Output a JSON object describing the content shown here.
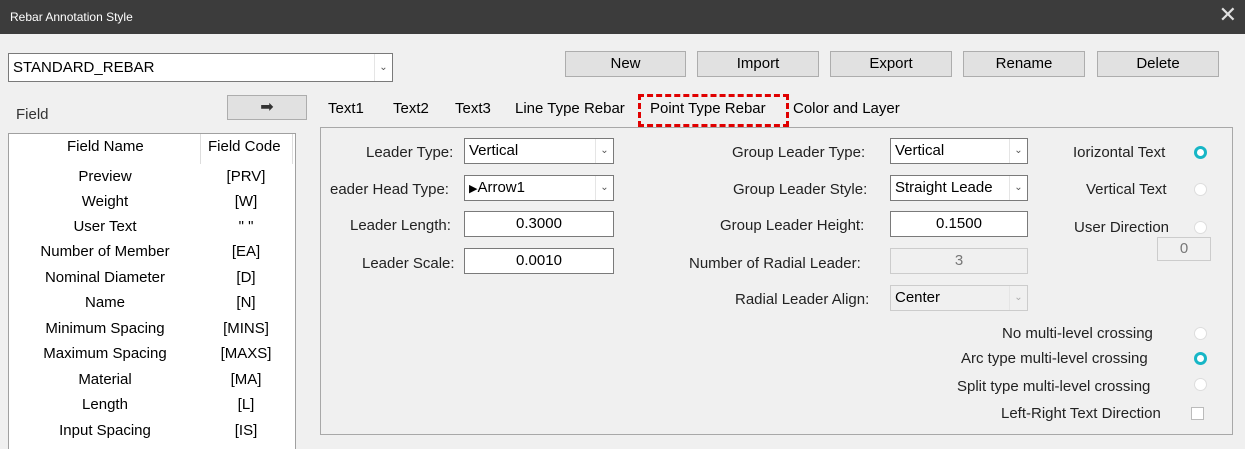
{
  "window": {
    "title": "Rebar Annotation Style",
    "close_glyph": "✕"
  },
  "style_select": {
    "value": "STANDARD_REBAR"
  },
  "toolbar": {
    "new": "New",
    "import": "Import",
    "export": "Export",
    "rename": "Rename",
    "delete": "Delete"
  },
  "field": {
    "label": "Field",
    "arrow": "➡",
    "headers": {
      "name": "Field Name",
      "code": "Field Code"
    },
    "rows": [
      {
        "name": "Preview",
        "code": "[PRV]"
      },
      {
        "name": "Weight",
        "code": "[W]"
      },
      {
        "name": "User Text",
        "code": "\" \""
      },
      {
        "name": "Number of Member",
        "code": "[EA]"
      },
      {
        "name": "Nominal Diameter",
        "code": "[D]"
      },
      {
        "name": "Name",
        "code": "[N]"
      },
      {
        "name": "Minimum Spacing",
        "code": "[MINS]"
      },
      {
        "name": "Maximum Spacing",
        "code": "[MAXS]"
      },
      {
        "name": "Material",
        "code": "[MA]"
      },
      {
        "name": "Length",
        "code": "[L]"
      },
      {
        "name": "Input Spacing",
        "code": "[IS]"
      }
    ]
  },
  "tabs": [
    "Text1",
    "Text2",
    "Text3",
    "Line Type Rebar",
    "Point Type Rebar",
    "Color and Layer"
  ],
  "active_tab": "Point Type Rebar",
  "form": {
    "leader_type": {
      "label": "Leader Type:",
      "value": "Vertical"
    },
    "leader_head_type": {
      "label": "eader Head Type:",
      "value": "Arrow1"
    },
    "leader_length": {
      "label": "Leader Length:",
      "value": "0.3000"
    },
    "leader_scale": {
      "label": "Leader Scale:",
      "value": "0.0010"
    },
    "group_leader_type": {
      "label": "Group Leader Type:",
      "value": "Vertical"
    },
    "group_leader_style": {
      "label": "Group Leader Style:",
      "value": "Straight Leade"
    },
    "group_leader_height": {
      "label": "Group Leader Height:",
      "value": "0.1500"
    },
    "radial_leader_count": {
      "label": "Number of Radial Leader:",
      "value": "3"
    },
    "radial_leader_align": {
      "label": "Radial Leader Align:",
      "value": "Center"
    },
    "horizontal_text": {
      "label": "Iorizontal Text",
      "checked": true
    },
    "vertical_text": {
      "label": "Vertical Text",
      "checked": false
    },
    "user_direction": {
      "label": "User Direction",
      "checked": false,
      "value": "0"
    },
    "no_multilevel": {
      "label": "No multi-level crossing",
      "checked": false
    },
    "arc_multilevel": {
      "label": "Arc type multi-level crossing",
      "checked": true
    },
    "split_multilevel": {
      "label": "Split type multi-level crossing",
      "checked": false
    },
    "lr_text_direction": {
      "label": "Left-Right Text Direction",
      "checked": false
    }
  }
}
